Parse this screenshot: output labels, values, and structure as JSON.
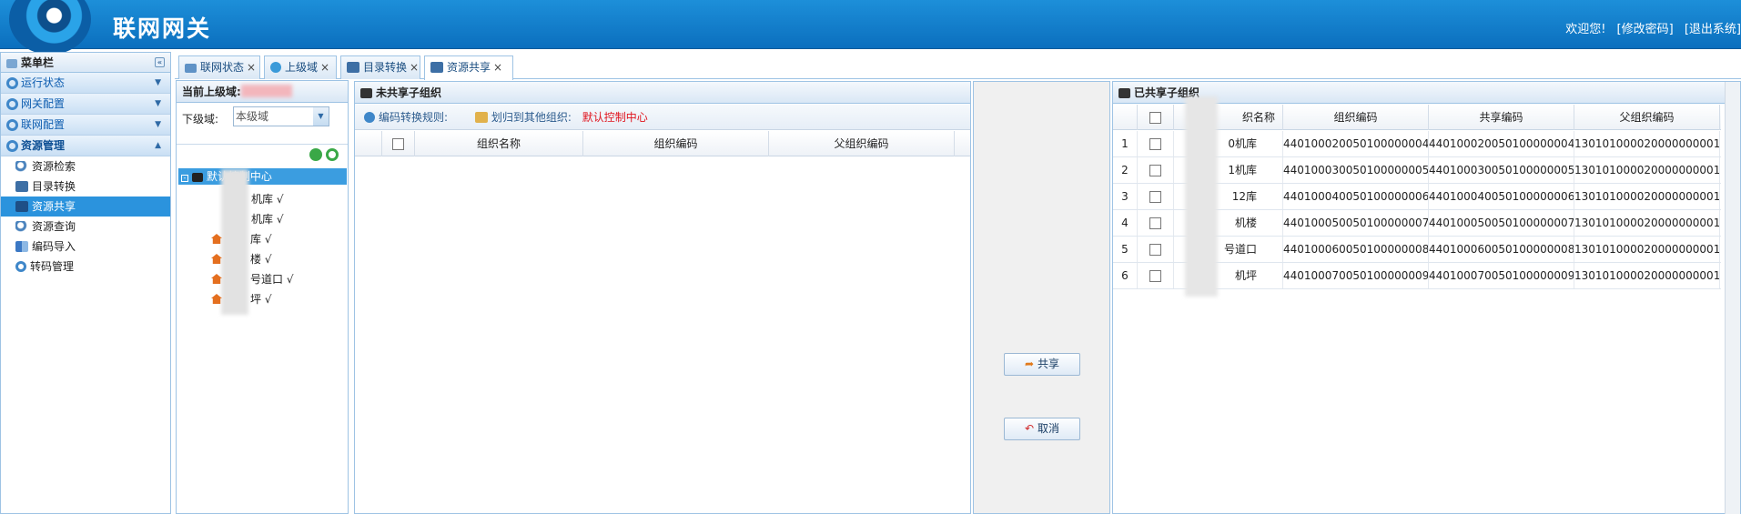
{
  "header": {
    "title": "联网网关",
    "welcome": "欢迎您!",
    "change_pwd": "[修改密码]",
    "logout": "[退出系统]"
  },
  "sidebar": {
    "title": "菜单栏",
    "sections": [
      {
        "label": "运行状态",
        "open": false
      },
      {
        "label": "网关配置",
        "open": false
      },
      {
        "label": "联网配置",
        "open": false
      },
      {
        "label": "资源管理",
        "open": true
      }
    ],
    "items": [
      {
        "label": "资源检索",
        "icon": "search-icon"
      },
      {
        "label": "目录转换",
        "icon": "monitor-icon"
      },
      {
        "label": "资源共享",
        "icon": "monitor-icon",
        "active": true
      },
      {
        "label": "资源查询",
        "icon": "search-icon"
      },
      {
        "label": "编码导入",
        "icon": "import-icon"
      },
      {
        "label": "转码管理",
        "icon": "refresh-icon"
      }
    ]
  },
  "tabs": [
    {
      "label": "联网状态",
      "icon": "network-icon"
    },
    {
      "label": "上级域",
      "icon": "globe-icon"
    },
    {
      "label": "目录转换",
      "icon": "monitor-icon"
    },
    {
      "label": "资源共享",
      "icon": "monitor-icon",
      "active": true
    }
  ],
  "tree_panel": {
    "title": "当前上级域:",
    "lower_domain_label": "下级域:",
    "lower_domain_value": "本级域",
    "root": "默认控制中心",
    "nodes": [
      "机库 √",
      "机库 √",
      "库 √",
      "楼 √",
      "号道口 √",
      "坪 √"
    ]
  },
  "unshared": {
    "title": "未共享子组织",
    "rule_label": "编码转换规则:",
    "move_label": "划归到其他组织:",
    "default_center": "默认控制中心",
    "columns": [
      "组织名称",
      "组织编码",
      "父组织编码"
    ]
  },
  "actions": {
    "share": "共享",
    "cancel": "取消"
  },
  "shared": {
    "title": "已共享子组织",
    "columns": [
      "织名称",
      "组织编码",
      "共享编码",
      "父组织编码"
    ],
    "rows": [
      {
        "n": "1",
        "name": "0机库",
        "org": "440100020050100000004",
        "share": "440100020050100000004",
        "parent": "130101000020000000001"
      },
      {
        "n": "2",
        "name": "1机库",
        "org": "440100030050100000005",
        "share": "440100030050100000005",
        "parent": "130101000020000000001"
      },
      {
        "n": "3",
        "name": "12库",
        "org": "440100040050100000006",
        "share": "440100040050100000006",
        "parent": "130101000020000000001"
      },
      {
        "n": "4",
        "name": "机楼",
        "org": "440100050050100000007",
        "share": "440100050050100000007",
        "parent": "130101000020000000001"
      },
      {
        "n": "5",
        "name": "号道口",
        "org": "440100060050100000008",
        "share": "440100060050100000008",
        "parent": "130101000020000000001"
      },
      {
        "n": "6",
        "name": "机坪",
        "org": "440100070050100000009",
        "share": "440100070050100000009",
        "parent": "130101000020000000001"
      }
    ]
  }
}
